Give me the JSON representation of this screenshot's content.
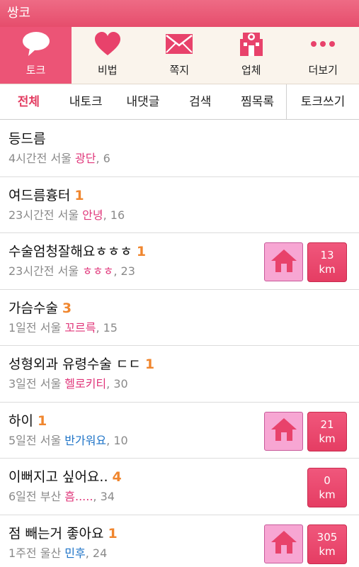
{
  "app": {
    "title": "쌍코"
  },
  "nav": [
    {
      "label": "토크",
      "icon": "speech-bubble-icon",
      "active": true
    },
    {
      "label": "비법",
      "icon": "heart-icon"
    },
    {
      "label": "쪽지",
      "icon": "envelope-icon"
    },
    {
      "label": "업체",
      "icon": "shop-icon"
    },
    {
      "label": "더보기",
      "icon": "more-dots-icon"
    }
  ],
  "tabs": [
    {
      "label": "전체",
      "active": true
    },
    {
      "label": "내토크"
    },
    {
      "label": "내댓글"
    },
    {
      "label": "검색"
    },
    {
      "label": "찜목록"
    },
    {
      "label": "토크쓰기"
    }
  ],
  "posts": [
    {
      "title": "등드름",
      "count": "",
      "time": "4시간전",
      "location": "서울",
      "nickname": "광단",
      "nick_color": "pink",
      "views": ", 6"
    },
    {
      "title": "여드름흉터",
      "count": "1",
      "time": "23시간전",
      "location": "서울",
      "nickname": "안녕",
      "nick_color": "pink",
      "views": ", 16"
    },
    {
      "title": "수술엄청잘해요ㅎㅎㅎ",
      "count": "1",
      "time": "23시간전",
      "location": "서울",
      "nickname": "ㅎㅎㅎ",
      "nick_color": "pink",
      "views": ", 23",
      "home": true,
      "distance": "13",
      "unit": "km"
    },
    {
      "title": "가슴수술",
      "count": "3",
      "time": "1일전",
      "location": "서울",
      "nickname": "꼬르륵",
      "nick_color": "pink",
      "views": ", 15"
    },
    {
      "title": "성형외과 유령수술 ㄷㄷ",
      "count": "1",
      "time": "3일전",
      "location": "서울",
      "nickname": "헬로키티",
      "nick_color": "pink",
      "views": ", 30"
    },
    {
      "title": "하이",
      "count": "1",
      "time": "5일전",
      "location": "서울",
      "nickname": "반가워요",
      "nick_color": "blue",
      "views": ", 10",
      "home": true,
      "distance": "21",
      "unit": "km"
    },
    {
      "title": "이뻐지고 싶어요..",
      "count": "4",
      "time": "6일전",
      "location": "부산",
      "nickname": "흠.....",
      "nick_color": "pink",
      "views": ", 34",
      "distance": "0",
      "unit": "km"
    },
    {
      "title": "점 빼는거 좋아요",
      "count": "1",
      "time": "1주전",
      "location": "울산",
      "nickname": "민후",
      "nick_color": "blue",
      "views": ", 24",
      "home": true,
      "distance": "305",
      "unit": "km"
    }
  ],
  "colors": {
    "accent": "#ec5476",
    "count": "#f0862e",
    "nick_pink": "#e0367a",
    "nick_blue": "#1d73c7",
    "home_btn": "#f7a6d3"
  }
}
